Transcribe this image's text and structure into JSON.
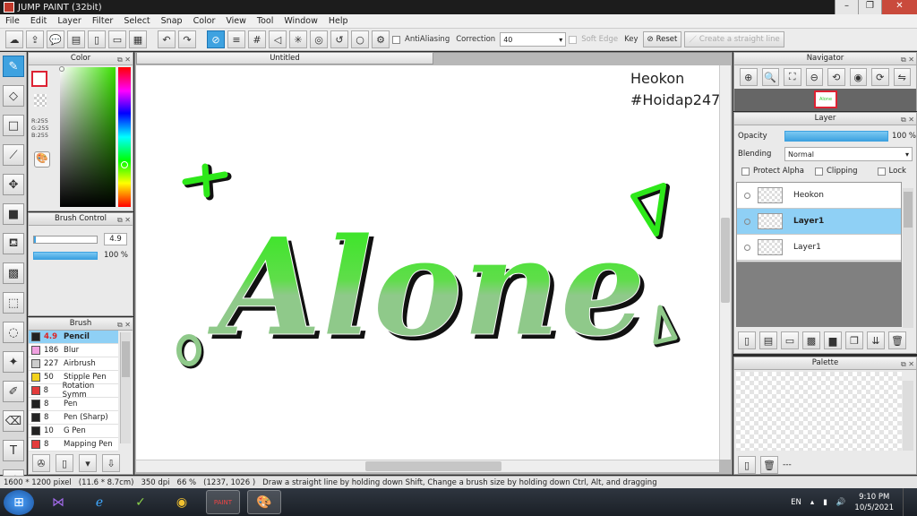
{
  "window": {
    "title": "JUMP PAINT (32bit)"
  },
  "menu": [
    "File",
    "Edit",
    "Layer",
    "Filter",
    "Select",
    "Snap",
    "Color",
    "View",
    "Tool",
    "Window",
    "Help"
  ],
  "toolbar": {
    "antialiasing_label": "AntiAliasing",
    "correction_label": "Correction",
    "correction_value": "40",
    "soft_edge_label": "Soft Edge",
    "key_label": "Key",
    "reset_label": "Reset",
    "straight_line_label": "Create a straight line"
  },
  "color_panel": {
    "title": "Color",
    "r": "R:255",
    "g": "G:255",
    "b": "B:255",
    "selected_color": "#ffffff"
  },
  "brush_control": {
    "title": "Brush Control",
    "size": "4.9",
    "opacity": "100 %"
  },
  "brush_panel": {
    "title": "Brush",
    "items": [
      {
        "size": "4.9",
        "name": "Pencil",
        "color": "#222222",
        "selected": true
      },
      {
        "size": "186",
        "name": "Blur",
        "color": "#f0a0e0"
      },
      {
        "size": "227",
        "name": "Airbrush",
        "color": "#cccccc"
      },
      {
        "size": "50",
        "name": "Stipple Pen",
        "color": "#f2d21b"
      },
      {
        "size": "8",
        "name": "Rotation Symm",
        "color": "#e33b3b"
      },
      {
        "size": "8",
        "name": "Pen",
        "color": "#222222"
      },
      {
        "size": "8",
        "name": "Pen (Sharp)",
        "color": "#222222"
      },
      {
        "size": "10",
        "name": "G Pen",
        "color": "#222222"
      },
      {
        "size": "8",
        "name": "Mapping Pen",
        "color": "#e33b3b"
      }
    ]
  },
  "document": {
    "tab": "Untitled",
    "watermark_line1": "Heokon",
    "watermark_line2": "#Hoidap247",
    "artwork_text": "Alone"
  },
  "navigator": {
    "title": "Navigator"
  },
  "layer_panel": {
    "title": "Layer",
    "opacity_label": "Opacity",
    "opacity_value": "100 %",
    "blending_label": "Blending",
    "blending_value": "Normal",
    "protect_alpha": "Protect Alpha",
    "clipping": "Clipping",
    "lock": "Lock",
    "layers": [
      {
        "name": "Heokon",
        "selected": false
      },
      {
        "name": "Layer1",
        "selected": true
      },
      {
        "name": "Layer1",
        "selected": false
      }
    ]
  },
  "palette_panel": {
    "title": "Palette",
    "footer": "---"
  },
  "status": {
    "size": "1600 * 1200 pixel",
    "cm": "(11.6 * 8.7cm)",
    "dpi": "350 dpi",
    "zoom": "66 %",
    "coords": "(1237, 1026 )",
    "hint": "Draw a straight line by holding down Shift, Change a brush size by holding down Ctrl, Alt, and dragging"
  },
  "taskbar": {
    "lang": "EN",
    "time": "9:10 PM",
    "date": "10/5/2021"
  },
  "colors": {
    "accent": "#3ea2e0",
    "art_green": "#2ee81a",
    "art_light": "#8fc98a"
  }
}
